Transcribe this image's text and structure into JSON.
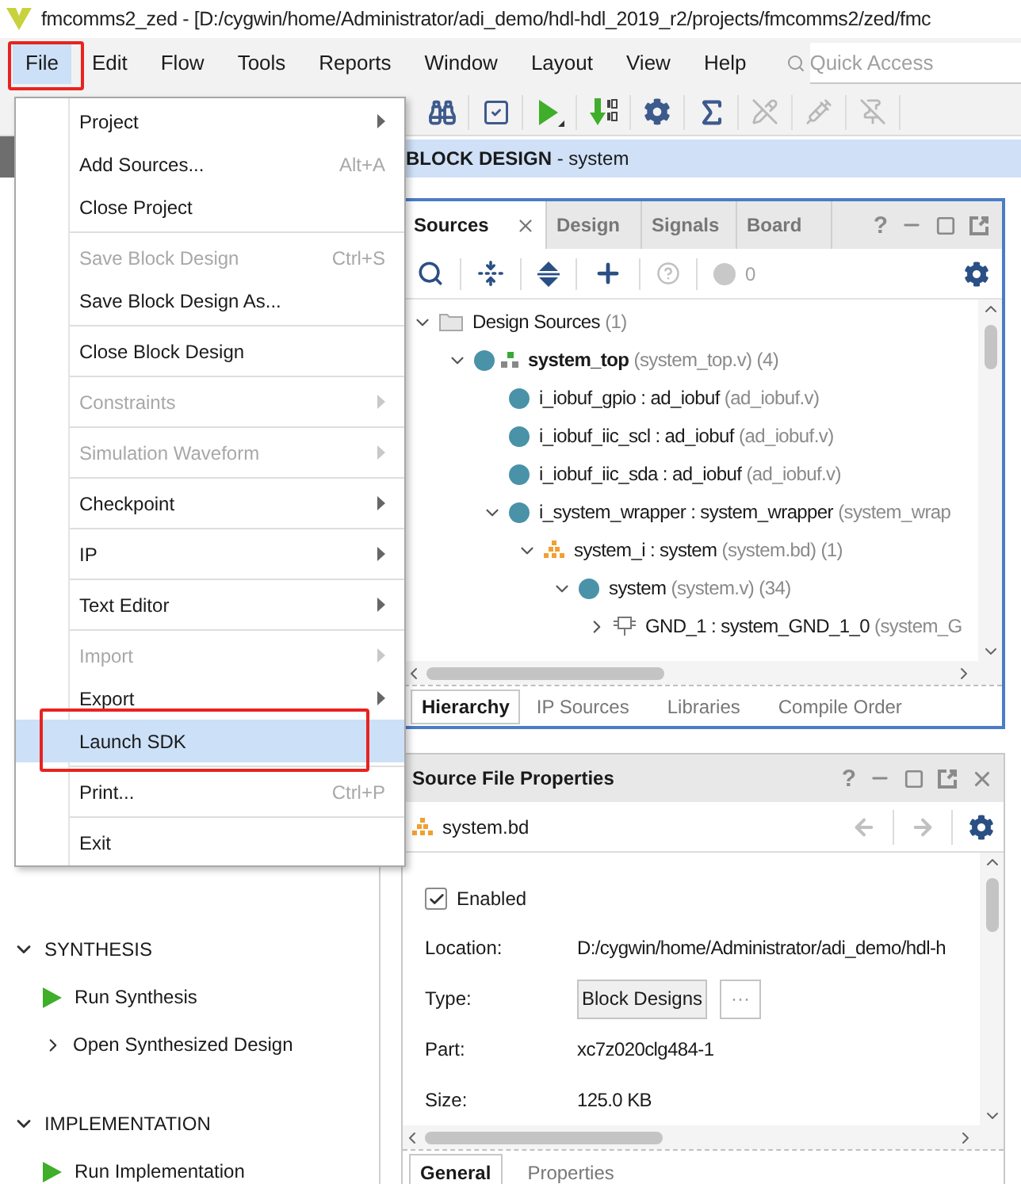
{
  "window": {
    "title": "fmcomms2_zed - [D:/cygwin/home/Administrator/adi_demo/hdl-hdl_2019_r2/projects/fmcomms2/zed/fmc"
  },
  "menubar": [
    {
      "label": "File",
      "selected": true
    },
    {
      "label": "Edit",
      "selected": false
    },
    {
      "label": "Flow",
      "selected": false
    },
    {
      "label": "Tools",
      "selected": false
    },
    {
      "label": "Reports",
      "selected": false
    },
    {
      "label": "Window",
      "selected": false
    },
    {
      "label": "Layout",
      "selected": false
    },
    {
      "label": "View",
      "selected": false
    },
    {
      "label": "Help",
      "selected": false
    }
  ],
  "quick_access": {
    "placeholder": "Quick Access"
  },
  "toolbar": [
    {
      "kind": "binoculars",
      "disabled": false
    },
    {
      "kind": "check",
      "disabled": false
    },
    {
      "kind": "run",
      "disabled": false
    },
    {
      "kind": "program",
      "disabled": false
    },
    {
      "kind": "gear",
      "disabled": false
    },
    {
      "kind": "sigma",
      "disabled": false
    },
    {
      "kind": "pencil-off",
      "disabled": true
    },
    {
      "kind": "syringe",
      "disabled": true
    },
    {
      "kind": "pin-off",
      "disabled": true
    }
  ],
  "file_menu": [
    {
      "kind": "item",
      "label": "Project",
      "submenu": true,
      "disabled": false,
      "selected": false
    },
    {
      "kind": "item",
      "label": "Add Sources...",
      "shortcut": "Alt+A",
      "submenu": false,
      "disabled": false,
      "selected": false
    },
    {
      "kind": "item",
      "label": "Close Project",
      "submenu": false,
      "disabled": false,
      "selected": false
    },
    {
      "kind": "separator"
    },
    {
      "kind": "item",
      "label": "Save Block Design",
      "shortcut": "Ctrl+S",
      "submenu": false,
      "disabled": true,
      "selected": false
    },
    {
      "kind": "item",
      "label": "Save Block Design As...",
      "submenu": false,
      "disabled": false,
      "selected": false
    },
    {
      "kind": "separator"
    },
    {
      "kind": "item",
      "label": "Close Block Design",
      "submenu": false,
      "disabled": false,
      "selected": false
    },
    {
      "kind": "separator"
    },
    {
      "kind": "item",
      "label": "Constraints",
      "submenu": true,
      "disabled": true,
      "selected": false
    },
    {
      "kind": "separator"
    },
    {
      "kind": "item",
      "label": "Simulation Waveform",
      "submenu": true,
      "disabled": true,
      "selected": false
    },
    {
      "kind": "separator"
    },
    {
      "kind": "item",
      "label": "Checkpoint",
      "submenu": true,
      "disabled": false,
      "selected": false
    },
    {
      "kind": "separator"
    },
    {
      "kind": "item",
      "label": "IP",
      "submenu": true,
      "disabled": false,
      "selected": false
    },
    {
      "kind": "separator"
    },
    {
      "kind": "item",
      "label": "Text Editor",
      "submenu": true,
      "disabled": false,
      "selected": false
    },
    {
      "kind": "separator"
    },
    {
      "kind": "item",
      "label": "Import",
      "submenu": true,
      "disabled": true,
      "selected": false
    },
    {
      "kind": "item",
      "label": "Export",
      "submenu": true,
      "disabled": false,
      "selected": false
    },
    {
      "kind": "item",
      "label": "Launch SDK",
      "submenu": false,
      "disabled": false,
      "selected": true
    },
    {
      "kind": "separator"
    },
    {
      "kind": "item",
      "label": "Print...",
      "shortcut": "Ctrl+P",
      "submenu": false,
      "disabled": false,
      "selected": false
    },
    {
      "kind": "separator"
    },
    {
      "kind": "item",
      "label": "Exit",
      "submenu": false,
      "disabled": false,
      "selected": false
    }
  ],
  "flow_navigator": [
    {
      "kind": "section",
      "label": "SYNTHESIS",
      "expanded": true
    },
    {
      "kind": "run",
      "label": "Run Synthesis"
    },
    {
      "kind": "open",
      "label": "Open Synthesized Design"
    },
    {
      "kind": "section",
      "label": "IMPLEMENTATION",
      "expanded": true
    },
    {
      "kind": "run",
      "label": "Run Implementation"
    }
  ],
  "editor_header": {
    "title": "**BLOCK DESIGN** - system"
  },
  "sources": {
    "tabs": [
      {
        "label": "Sources",
        "selected": true
      },
      {
        "label": "Design",
        "selected": false
      },
      {
        "label": "Signals",
        "selected": false
      },
      {
        "label": "Board",
        "selected": false
      }
    ],
    "help": "?",
    "warning_count": "0",
    "tree": [
      {
        "kind": "folder",
        "name": "Design Sources",
        "detail": "(1)",
        "expanded": true,
        "children": [
          {
            "kind": "top",
            "name": "system_top",
            "detail": "(system_top.v) (4)",
            "expanded": true,
            "children": [
              {
                "kind": "module",
                "name": "i_iobuf_gpio : ad_iobuf",
                "detail": "(ad_iobuf.v)"
              },
              {
                "kind": "module",
                "name": "i_iobuf_iic_scl : ad_iobuf",
                "detail": "(ad_iobuf.v)"
              },
              {
                "kind": "module",
                "name": "i_iobuf_iic_sda : ad_iobuf",
                "detail": "(ad_iobuf.v)"
              },
              {
                "kind": "module",
                "name": "i_system_wrapper : system_wrapper",
                "detail": "(system_wrap",
                "expanded": true,
                "children": [
                  {
                    "kind": "block-design",
                    "name": "system_i : system",
                    "detail": "(system.bd) (1)",
                    "expanded": true,
                    "children": [
                      {
                        "kind": "module",
                        "name": "system",
                        "detail": "(system.v) (34)",
                        "expanded": true,
                        "children": [
                          {
                            "kind": "ip",
                            "name": "GND_1 : system_GND_1_0",
                            "detail": "(system_G",
                            "expanded": false
                          }
                        ]
                      }
                    ]
                  }
                ]
              }
            ]
          }
        ]
      }
    ],
    "bottom_tabs": [
      {
        "label": "Hierarchy",
        "selected": true
      },
      {
        "label": "IP Sources",
        "selected": false
      },
      {
        "label": "Libraries",
        "selected": false
      },
      {
        "label": "Compile Order",
        "selected": false
      }
    ]
  },
  "properties": {
    "title": "Source File Properties",
    "help": "?",
    "file": "system.bd",
    "enabled": {
      "label": "Enabled",
      "checked": true
    },
    "fields": [
      {
        "kind": "text",
        "label": "Location:",
        "value": "D:/cygwin/home/Administrator/adi_demo/hdl-h"
      },
      {
        "kind": "button",
        "label": "Type:",
        "value": "Block Designs",
        "browse": "···"
      },
      {
        "kind": "text",
        "label": "Part:",
        "value": "xc7z020clg484-1"
      },
      {
        "kind": "text",
        "label": "Size:",
        "value": "125.0 KB"
      }
    ],
    "tabs": [
      {
        "label": "General",
        "selected": true
      },
      {
        "label": "Properties",
        "selected": false
      }
    ]
  }
}
